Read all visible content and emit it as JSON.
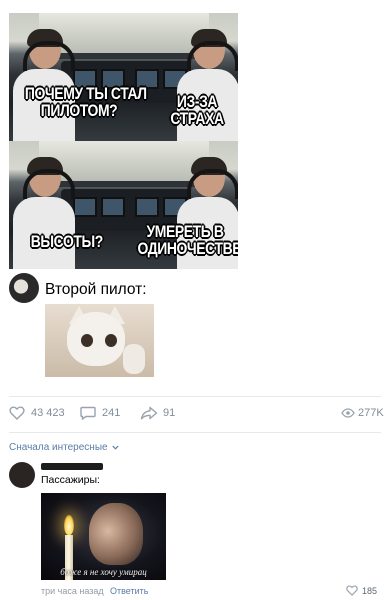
{
  "meme": {
    "top_left_caption": [
      "ПОЧЕМУ ТЫ СТАЛ",
      "ПИЛОТОМ?"
    ],
    "top_right_caption": [
      "ИЗ-ЗА",
      "СТРАХА"
    ],
    "bottom_left_caption": [
      "ВЫСОТЫ?"
    ],
    "bottom_right_caption": [
      "УМЕРЕТЬ В",
      "ОДИНОЧЕСТВЕ"
    ]
  },
  "post": {
    "line_text": "Второй пилот:"
  },
  "stats": {
    "likes": "43 423",
    "comments": "241",
    "shares": "91",
    "views": "277K"
  },
  "comments": {
    "sort_label": "Сначала интересные",
    "items": [
      {
        "text": "Пассажиры:",
        "image_caption": "боже я не хочу умирац",
        "time": "три часа назад",
        "reply_label": "Ответить",
        "likes": "185"
      }
    ]
  }
}
